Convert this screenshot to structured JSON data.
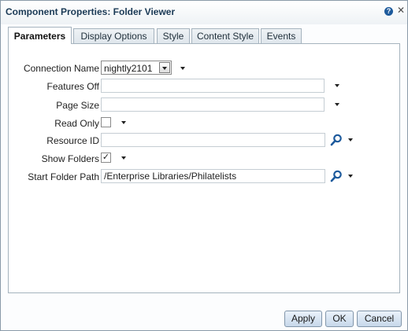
{
  "dialog": {
    "title": "Component Properties: Folder Viewer"
  },
  "tabs": [
    {
      "label": "Parameters",
      "active": true
    },
    {
      "label": "Display Options",
      "active": false
    },
    {
      "label": "Style",
      "active": false
    },
    {
      "label": "Content Style",
      "active": false
    },
    {
      "label": "Events",
      "active": false
    }
  ],
  "fields": {
    "connection_name": {
      "label": "Connection Name",
      "value": "nightly2101"
    },
    "features_off": {
      "label": "Features Off",
      "value": ""
    },
    "page_size": {
      "label": "Page Size",
      "value": ""
    },
    "read_only": {
      "label": "Read Only",
      "checked": false
    },
    "resource_id": {
      "label": "Resource ID",
      "value": ""
    },
    "show_folders": {
      "label": "Show Folders",
      "checked": true,
      "check_glyph": "✓"
    },
    "start_folder_path": {
      "label": "Start Folder Path",
      "value": "/Enterprise Libraries/Philatelists"
    }
  },
  "buttons": {
    "apply": "Apply",
    "ok": "OK",
    "cancel": "Cancel"
  },
  "icons": {
    "help": "?",
    "close": "✕"
  },
  "colors": {
    "title_text": "#1b3a56",
    "search_icon": "#1d5a9c",
    "button_gradient_top": "#eaf2fb",
    "button_gradient_bottom": "#c7d8ea"
  }
}
